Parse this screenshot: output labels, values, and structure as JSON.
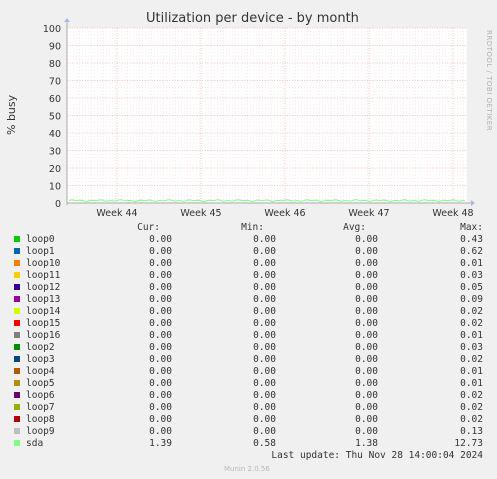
{
  "chart_data": {
    "type": "line",
    "title": "Utilization per device - by month",
    "ylabel": "% busy",
    "ylim": [
      0,
      100
    ],
    "yticks": [
      0,
      10,
      20,
      30,
      40,
      50,
      60,
      70,
      80,
      90,
      100
    ],
    "xticks": [
      "Week 44",
      "Week 45",
      "Week 46",
      "Week 47",
      "Week 48"
    ],
    "vertical_label": "RRDTOOL / TOBI OETIKER",
    "grid": true,
    "series": [
      {
        "name": "loop0",
        "color": "#00cc00",
        "cur": "0.00",
        "min": "0.00",
        "avg": "0.00",
        "max": "0.43"
      },
      {
        "name": "loop1",
        "color": "#0066b3",
        "cur": "0.00",
        "min": "0.00",
        "avg": "0.00",
        "max": "0.62"
      },
      {
        "name": "loop10",
        "color": "#ff8000",
        "cur": "0.00",
        "min": "0.00",
        "avg": "0.00",
        "max": "0.01"
      },
      {
        "name": "loop11",
        "color": "#ffcc00",
        "cur": "0.00",
        "min": "0.00",
        "avg": "0.00",
        "max": "0.03"
      },
      {
        "name": "loop12",
        "color": "#330099",
        "cur": "0.00",
        "min": "0.00",
        "avg": "0.00",
        "max": "0.05"
      },
      {
        "name": "loop13",
        "color": "#990099",
        "cur": "0.00",
        "min": "0.00",
        "avg": "0.00",
        "max": "0.09"
      },
      {
        "name": "loop14",
        "color": "#ccff00",
        "cur": "0.00",
        "min": "0.00",
        "avg": "0.00",
        "max": "0.02"
      },
      {
        "name": "loop15",
        "color": "#ff0000",
        "cur": "0.00",
        "min": "0.00",
        "avg": "0.00",
        "max": "0.02"
      },
      {
        "name": "loop16",
        "color": "#808080",
        "cur": "0.00",
        "min": "0.00",
        "avg": "0.00",
        "max": "0.01"
      },
      {
        "name": "loop2",
        "color": "#008f00",
        "cur": "0.00",
        "min": "0.00",
        "avg": "0.00",
        "max": "0.03"
      },
      {
        "name": "loop3",
        "color": "#00487d",
        "cur": "0.00",
        "min": "0.00",
        "avg": "0.00",
        "max": "0.02"
      },
      {
        "name": "loop4",
        "color": "#b35a00",
        "cur": "0.00",
        "min": "0.00",
        "avg": "0.00",
        "max": "0.01"
      },
      {
        "name": "loop5",
        "color": "#b38f00",
        "cur": "0.00",
        "min": "0.00",
        "avg": "0.00",
        "max": "0.01"
      },
      {
        "name": "loop6",
        "color": "#6b006b",
        "cur": "0.00",
        "min": "0.00",
        "avg": "0.00",
        "max": "0.02"
      },
      {
        "name": "loop7",
        "color": "#8fb300",
        "cur": "0.00",
        "min": "0.00",
        "avg": "0.00",
        "max": "0.02"
      },
      {
        "name": "loop8",
        "color": "#b30000",
        "cur": "0.00",
        "min": "0.00",
        "avg": "0.00",
        "max": "0.02"
      },
      {
        "name": "loop9",
        "color": "#bebebe",
        "cur": "0.00",
        "min": "0.00",
        "avg": "0.00",
        "max": "0.13"
      },
      {
        "name": "sda",
        "color": "#80ff80",
        "cur": "1.39",
        "min": "0.58",
        "avg": "1.38",
        "max": "12.73"
      }
    ]
  },
  "legend_headers": {
    "cur": "Cur:",
    "min": "Min:",
    "avg": "Avg:",
    "max": "Max:"
  },
  "footer": {
    "last_update": "Last update: Thu Nov 28 14:00:04 2024",
    "munin": "Munin 2.0.56"
  }
}
